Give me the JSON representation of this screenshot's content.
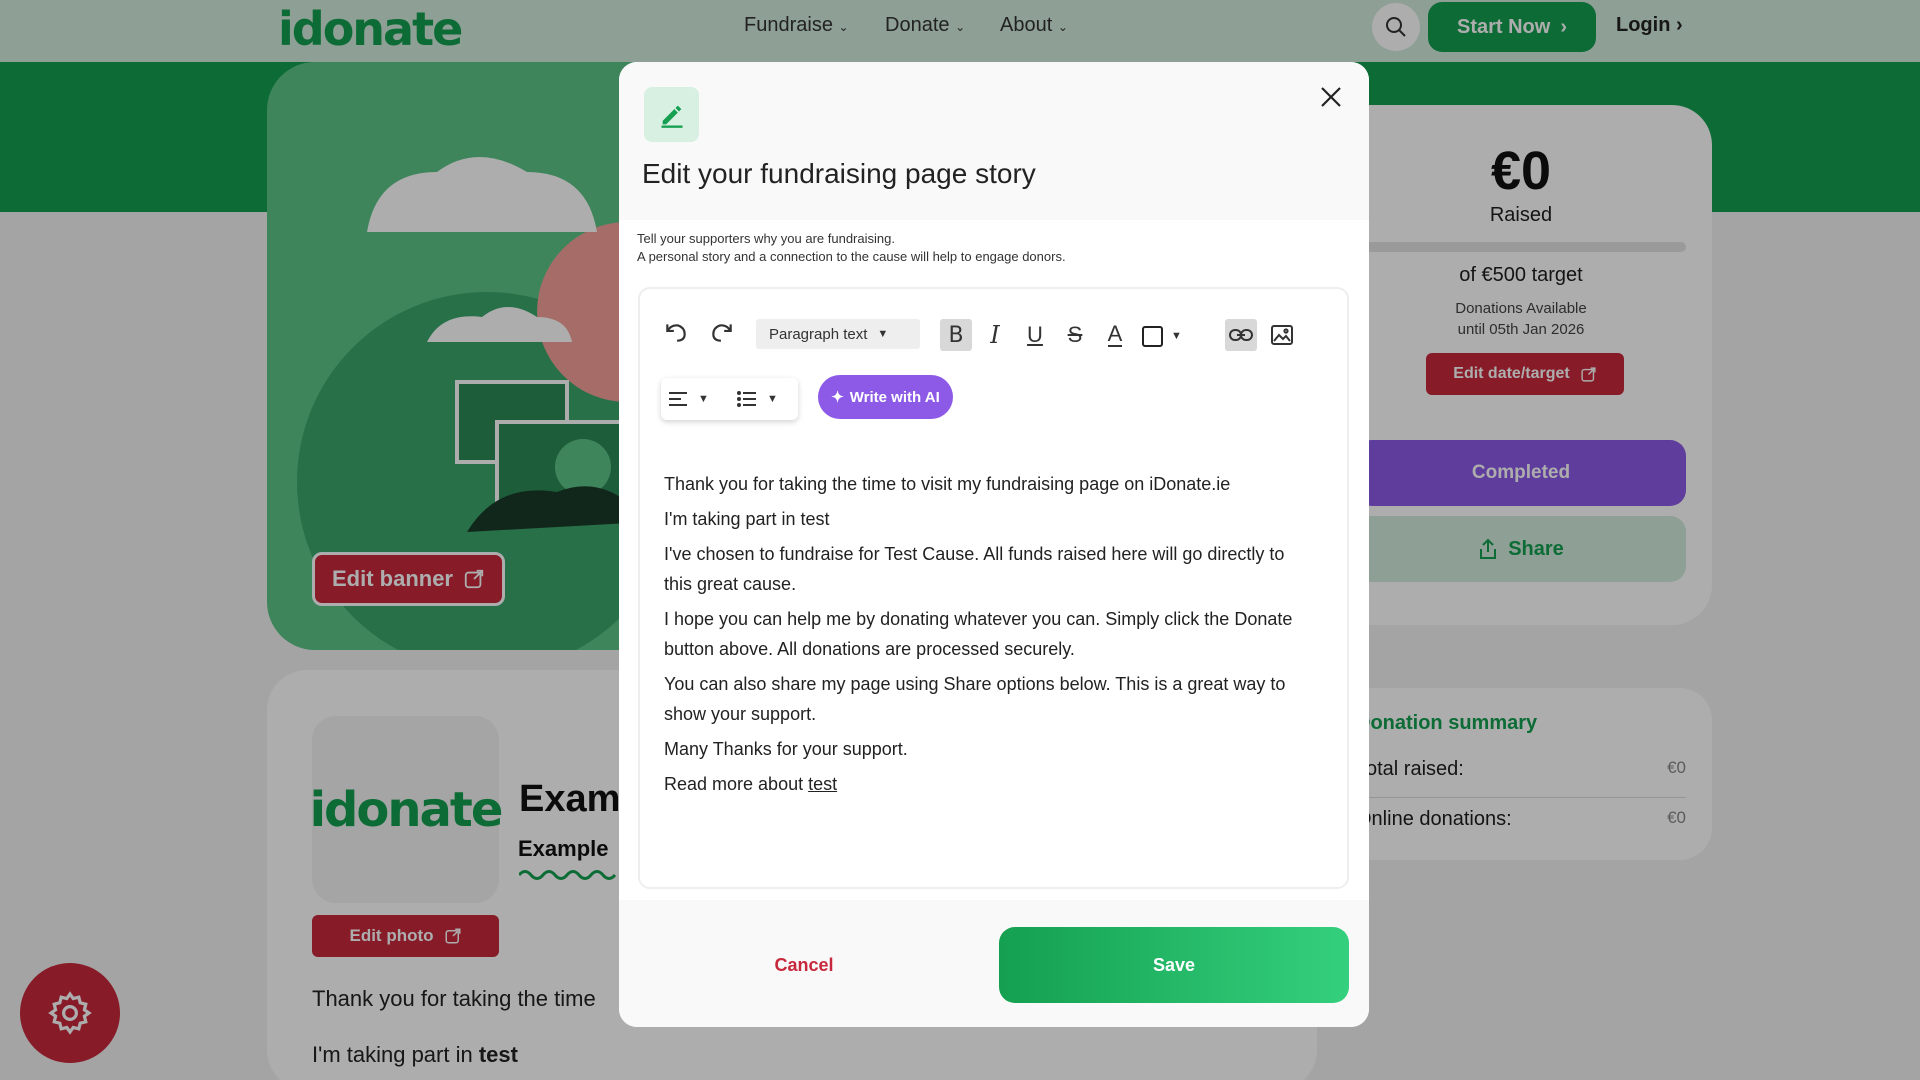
{
  "nav": {
    "logo": "idonate",
    "links": [
      "Fundraise",
      "Donate",
      "About"
    ],
    "start_now": "Start Now",
    "login": "Login"
  },
  "banner": {
    "edit_banner": "Edit banner"
  },
  "profile": {
    "logo": "idonate",
    "title_partial": "Exam",
    "subtitle_partial": "Example",
    "edit_photo": "Edit photo",
    "story_line1": "Thank you for taking the time",
    "story_line2_prefix": "I'm taking part in ",
    "story_line2_bold": "test"
  },
  "sidebar": {
    "amount": "€0",
    "raised_label": "Raised",
    "target": "of €500 target",
    "available_line1": "Donations Available",
    "available_line2": "until 05th Jan 2026",
    "edit_date_target": "Edit date/target",
    "completed": "Completed",
    "share": "Share",
    "progress": 0
  },
  "summary": {
    "title": "Donation summary",
    "rows": [
      {
        "label": "Total raised:",
        "value": "€0"
      },
      {
        "label": "Online donations:",
        "value": "€0"
      }
    ]
  },
  "modal": {
    "title": "Edit your fundraising page story",
    "desc1": "Tell your supporters why you are fundraising.",
    "desc2": "A personal story and a connection to the cause will help to engage donors.",
    "paragraph_style": "Paragraph text",
    "write_ai": "Write with AI",
    "story": [
      "Thank you for taking the time to visit my fundraising page on iDonate.ie",
      "I'm taking part in test",
      "I've chosen to fundraise for Test Cause. All funds raised here will go directly to this great cause.",
      "I hope you can help me by donating whatever you can. Simply click the Donate button above. All donations are processed securely.",
      "You can also share my page using Share options below. This is a great way to show your support.",
      "Many Thanks for your support."
    ],
    "read_more_prefix": "Read more about ",
    "read_more_link": "test",
    "cancel": "Cancel",
    "save": "Save"
  },
  "colors": {
    "brand_green": "#14a050",
    "red": "#c8283c",
    "purple": "#8c5ae6"
  }
}
